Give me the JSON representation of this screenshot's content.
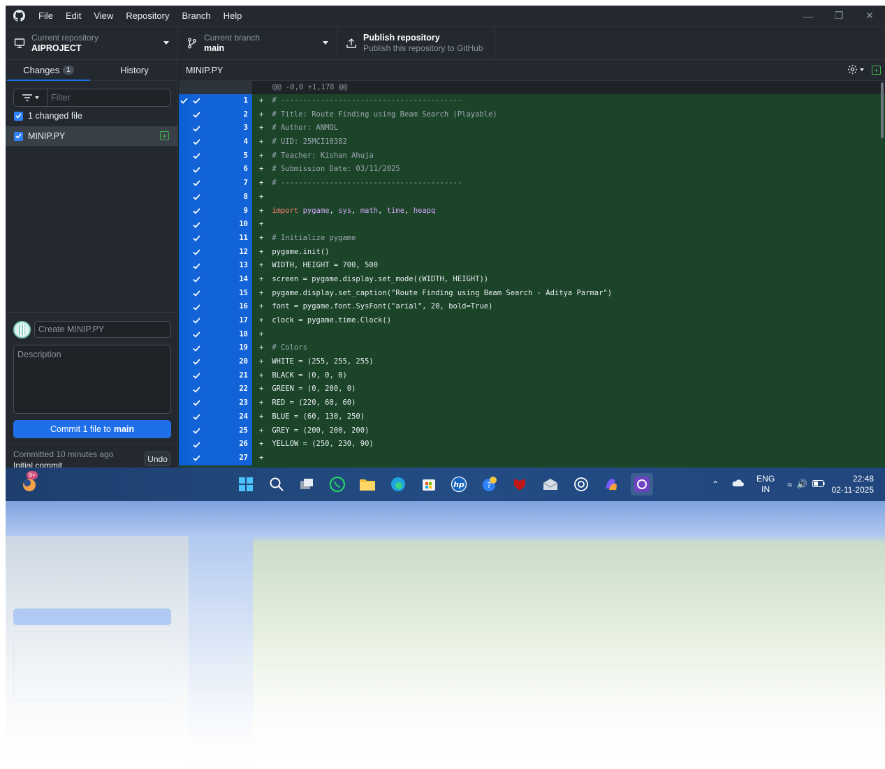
{
  "app": {
    "menu": [
      "File",
      "Edit",
      "View",
      "Repository",
      "Branch",
      "Help"
    ]
  },
  "toolbar": {
    "repo_label": "Current repository",
    "repo_name": "AIPROJECT",
    "branch_label": "Current branch",
    "branch_name": "main",
    "publish_title": "Publish repository",
    "publish_sub": "Publish this repository to GitHub"
  },
  "sidebar": {
    "tab_changes": "Changes",
    "tab_changes_count": "1",
    "tab_history": "History",
    "filter_placeholder": "Filter",
    "changed_files": "1 changed file",
    "file_name": "MINIP.PY",
    "summary_placeholder": "Create MINIP.PY",
    "description_placeholder": "Description",
    "commit_prefix": "Commit 1 file to",
    "commit_branch": "main",
    "last_commit_ago": "Committed 10 minutes ago",
    "last_commit_msg": "Initial commit",
    "undo": "Undo"
  },
  "diff": {
    "file_name": "MINIP.PY",
    "hunk_header": "@@ -0,0 +1,178 @@",
    "lines": [
      {
        "n": "1",
        "text": "# -----------------------------------------"
      },
      {
        "n": "2",
        "text": "# Title: Route Finding using Beam Search (Playable)"
      },
      {
        "n": "3",
        "text": "# Author: ANMOL"
      },
      {
        "n": "4",
        "text": "# UID: 25MCI10382"
      },
      {
        "n": "5",
        "text": "# Teacher: Kishan Ahuja"
      },
      {
        "n": "6",
        "text": "# Submission Date: 03/11/2025"
      },
      {
        "n": "7",
        "text": "# -----------------------------------------"
      },
      {
        "n": "8",
        "text": ""
      },
      {
        "n": "9",
        "text": "import pygame, sys, math, time, heapq"
      },
      {
        "n": "10",
        "text": ""
      },
      {
        "n": "11",
        "text": "# Initialize pygame"
      },
      {
        "n": "12",
        "text": "pygame.init()"
      },
      {
        "n": "13",
        "text": "WIDTH, HEIGHT = 700, 500"
      },
      {
        "n": "14",
        "text": "screen = pygame.display.set_mode((WIDTH, HEIGHT))"
      },
      {
        "n": "15",
        "text": "pygame.display.set_caption(\"Route Finding using Beam Search - Aditya Parmar\")"
      },
      {
        "n": "16",
        "text": "font = pygame.font.SysFont(\"arial\", 20, bold=True)"
      },
      {
        "n": "17",
        "text": "clock = pygame.time.Clock()"
      },
      {
        "n": "18",
        "text": ""
      },
      {
        "n": "19",
        "text": "# Colors"
      },
      {
        "n": "20",
        "text": "WHITE = (255, 255, 255)"
      },
      {
        "n": "21",
        "text": "BLACK = (0, 0, 0)"
      },
      {
        "n": "22",
        "text": "GREEN = (0, 200, 0)"
      },
      {
        "n": "23",
        "text": "RED = (220, 60, 60)"
      },
      {
        "n": "24",
        "text": "BLUE = (60, 130, 250)"
      },
      {
        "n": "25",
        "text": "GREY = (200, 200, 200)"
      },
      {
        "n": "26",
        "text": "YELLOW = (250, 230, 90)"
      },
      {
        "n": "27",
        "text": ""
      }
    ]
  },
  "taskbar": {
    "start_badge": "9+",
    "apps": [
      "windows-start-icon",
      "search-icon",
      "task-view-icon",
      "whatsapp-icon",
      "file-explorer-icon",
      "edge-icon",
      "store-icon",
      "hp-icon",
      "help-icon",
      "mcafee-icon",
      "mail-icon",
      "chatgpt-icon",
      "copilot-icon",
      "github-desktop-icon"
    ],
    "lang_top": "ENG",
    "lang_bottom": "IN",
    "time": "22:48",
    "date": "02-11-2025"
  },
  "colors": {
    "accent": "#1f6feb",
    "added_bg": "#1c4428",
    "gutter_selected": "#1263d8"
  }
}
